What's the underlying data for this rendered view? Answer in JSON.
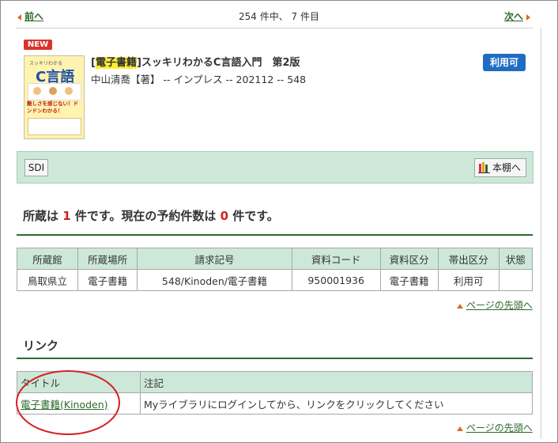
{
  "nav": {
    "prev_label": "前へ",
    "next_label": "次へ",
    "position_text": "254 件中、 7 件目"
  },
  "record": {
    "new_badge": "NEW",
    "title_highlight": "電子書籍",
    "title_rest": "スッキリわかるC言語入門　第2版",
    "meta": "中山清喬【著】 -- インプレス -- 202112 -- 548",
    "availability": "利用可",
    "cover_title": "C言語",
    "cover_sub": "スッキリわかる",
    "cover_tagline": "難しさを感じない！ドンドンわかる！"
  },
  "toolbar": {
    "sdi_label": "SDI",
    "shelf_label": "本棚へ"
  },
  "holdings": {
    "prefix": "所蔵は ",
    "count": "1",
    "middle": " 件です。現在の予約件数は ",
    "reserve_count": "0",
    "suffix": " 件です。"
  },
  "holdings_table": {
    "headers": [
      "所蔵館",
      "所蔵場所",
      "請求記号",
      "資料コード",
      "資料区分",
      "帯出区分",
      "状態"
    ],
    "rows": [
      [
        "鳥取県立",
        "電子書籍",
        "548/Kinoden/電子書籍",
        "950001936",
        "電子書籍",
        "利用可",
        ""
      ]
    ]
  },
  "page_top_label": "ページの先頭へ",
  "links": {
    "heading": "リンク",
    "headers": [
      "タイトル",
      "注記"
    ],
    "rows": [
      [
        "電子書籍(Kinoden)",
        "Myライブラリにログインしてから、リンクをクリックしてください"
      ]
    ]
  },
  "colors": {
    "accent_green": "#2d6a2d",
    "header_bg": "#cde8d8",
    "badge_blue": "#1e6cc4",
    "new_red": "#d9342b",
    "annotation_red": "#d41f1f"
  }
}
